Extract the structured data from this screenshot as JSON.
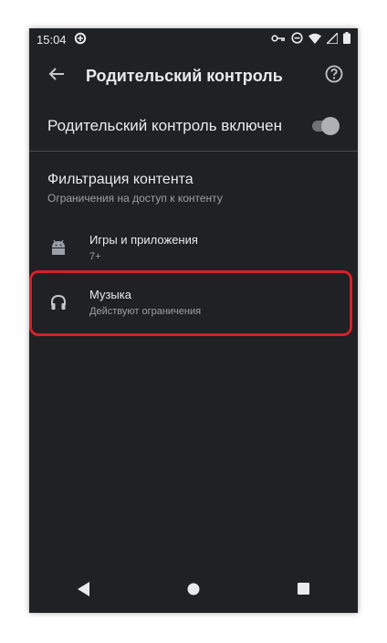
{
  "status_bar": {
    "time": "15:04",
    "icons_left": [
      "data-saver-icon"
    ],
    "icons_right": [
      "vpn-key-icon",
      "do-not-disturb-icon",
      "wifi-icon",
      "signal-icon",
      "battery-icon"
    ]
  },
  "app_bar": {
    "title": "Родительский контроль",
    "back_icon": "arrow-back-icon",
    "help_icon": "help-circle-icon"
  },
  "parental_toggle": {
    "label": "Родительский контроль включен",
    "state": "on"
  },
  "content_filtering": {
    "title": "Фильтрация контента",
    "subtitle": "Ограничения на доступ к контенту",
    "items": [
      {
        "icon": "android-icon",
        "title": "Игры и приложения",
        "subtitle": "7+"
      },
      {
        "icon": "headphones-icon",
        "title": "Музыка",
        "subtitle": "Действуют ограничения"
      }
    ]
  },
  "nav_bar": {
    "buttons": [
      "back-triangle-icon",
      "home-circle-icon",
      "recents-square-icon"
    ]
  },
  "colors": {
    "background": "#202124",
    "text_primary": "#e8eaed",
    "text_secondary": "#9aa0a6",
    "highlight": "#d3222a"
  }
}
